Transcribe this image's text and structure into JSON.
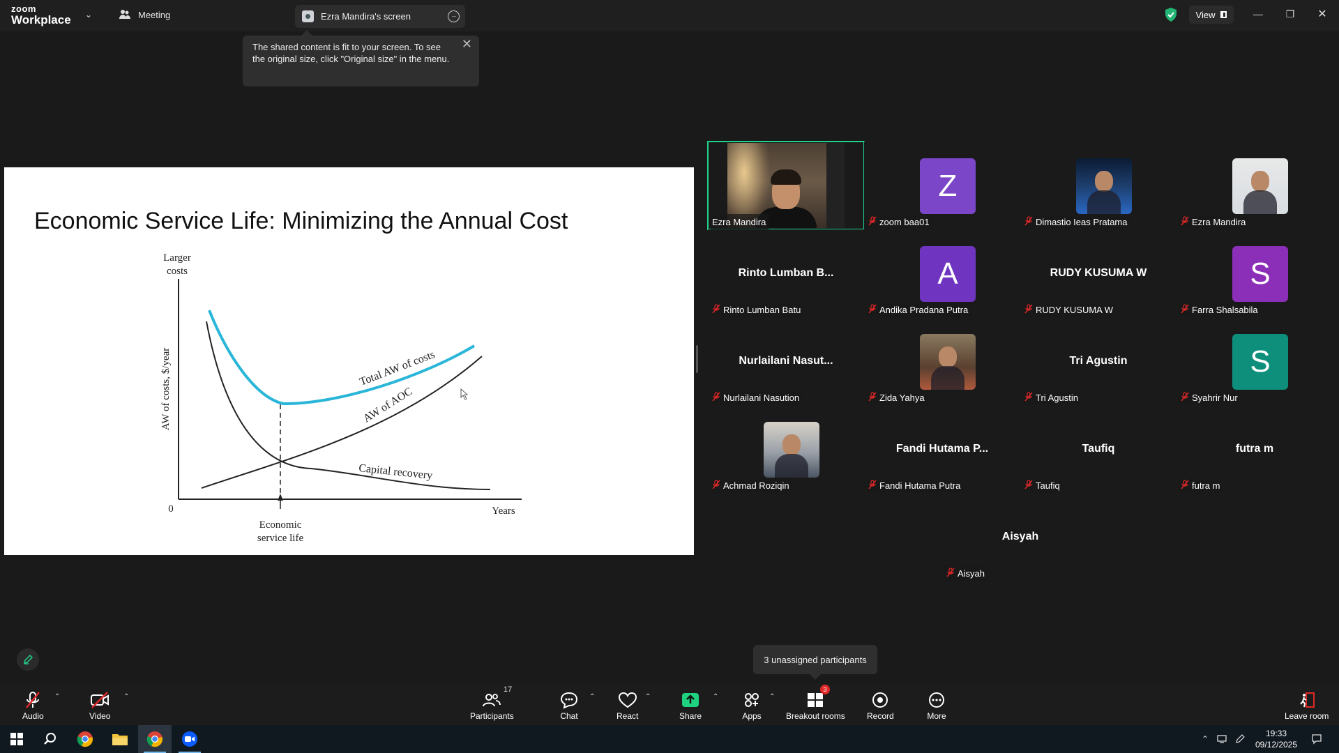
{
  "app": {
    "logo_line1": "zoom",
    "logo_line2": "Workplace",
    "meeting_tab": "Meeting",
    "screen_tab": "Ezra Mandira's screen",
    "view_label": "View",
    "secure_color": "#22b573"
  },
  "toast": {
    "text": "The shared content is fit to your screen. To see the original size, click \"Original size\" in the menu."
  },
  "slide": {
    "title": "Economic Service Life: Minimizing the Annual Cost"
  },
  "chart_data": {
    "type": "line",
    "ylabel": "AW of costs, $/year",
    "y_top_label_line1": "Larger",
    "y_top_label_line2": "costs",
    "origin_label": "0",
    "xlabel": "Years",
    "marker_label_line1": "Economic",
    "marker_label_line2": "service life",
    "series": [
      {
        "name": "Total AW of costs",
        "color": "#29b6d8"
      },
      {
        "name": "AW of AOC",
        "color": "#222222"
      },
      {
        "name": "Capital recovery",
        "color": "#222222"
      }
    ]
  },
  "participants": [
    {
      "name": "Ezra Mandira",
      "display": "video",
      "active": true
    },
    {
      "name": "zoom baa01",
      "display": "letter",
      "letter": "Z",
      "color": "#7b46c8"
    },
    {
      "name": "Dimastio Ieas Pratama",
      "display": "photo"
    },
    {
      "name": "Ezra Mandira",
      "display": "photo"
    },
    {
      "name": "Rinto Lumban Batu",
      "display": "name",
      "big": "Rinto Lumban B..."
    },
    {
      "name": "Andika Pradana Putra",
      "display": "letter",
      "letter": "A",
      "color": "#6f35c0"
    },
    {
      "name": "RUDY KUSUMA W",
      "display": "name",
      "big": "RUDY KUSUMA W"
    },
    {
      "name": "Farra Shalsabila",
      "display": "letter",
      "letter": "S",
      "color": "#8b2fb8"
    },
    {
      "name": "Nurlailani Nasution",
      "display": "name",
      "big": "Nurlailani  Nasut..."
    },
    {
      "name": "Zida Yahya",
      "display": "photo"
    },
    {
      "name": "Tri Agustin",
      "display": "name",
      "big": "Tri Agustin"
    },
    {
      "name": "Syahrir Nur",
      "display": "letter",
      "letter": "S",
      "color": "#0e8f7c"
    },
    {
      "name": "Achmad Roziqin",
      "display": "photo"
    },
    {
      "name": "Fandi Hutama Putra",
      "display": "name",
      "big": "Fandi Hutama P..."
    },
    {
      "name": "Taufiq",
      "display": "name",
      "big": "Taufiq"
    },
    {
      "name": "futra m",
      "display": "name",
      "big": "futra m"
    },
    {
      "name": "Aisyah",
      "display": "name",
      "big": "Aisyah"
    }
  ],
  "tooltip": {
    "unassigned": "3 unassigned participants"
  },
  "toolbar": {
    "audio": "Audio",
    "video": "Video",
    "participants": "Participants",
    "participants_count": "17",
    "chat": "Chat",
    "react": "React",
    "share": "Share",
    "apps": "Apps",
    "breakout": "Breakout rooms",
    "breakout_badge": "3",
    "record": "Record",
    "more": "More",
    "leave": "Leave room"
  },
  "taskbar": {
    "time": "19:33",
    "date": "09/12/2025"
  }
}
